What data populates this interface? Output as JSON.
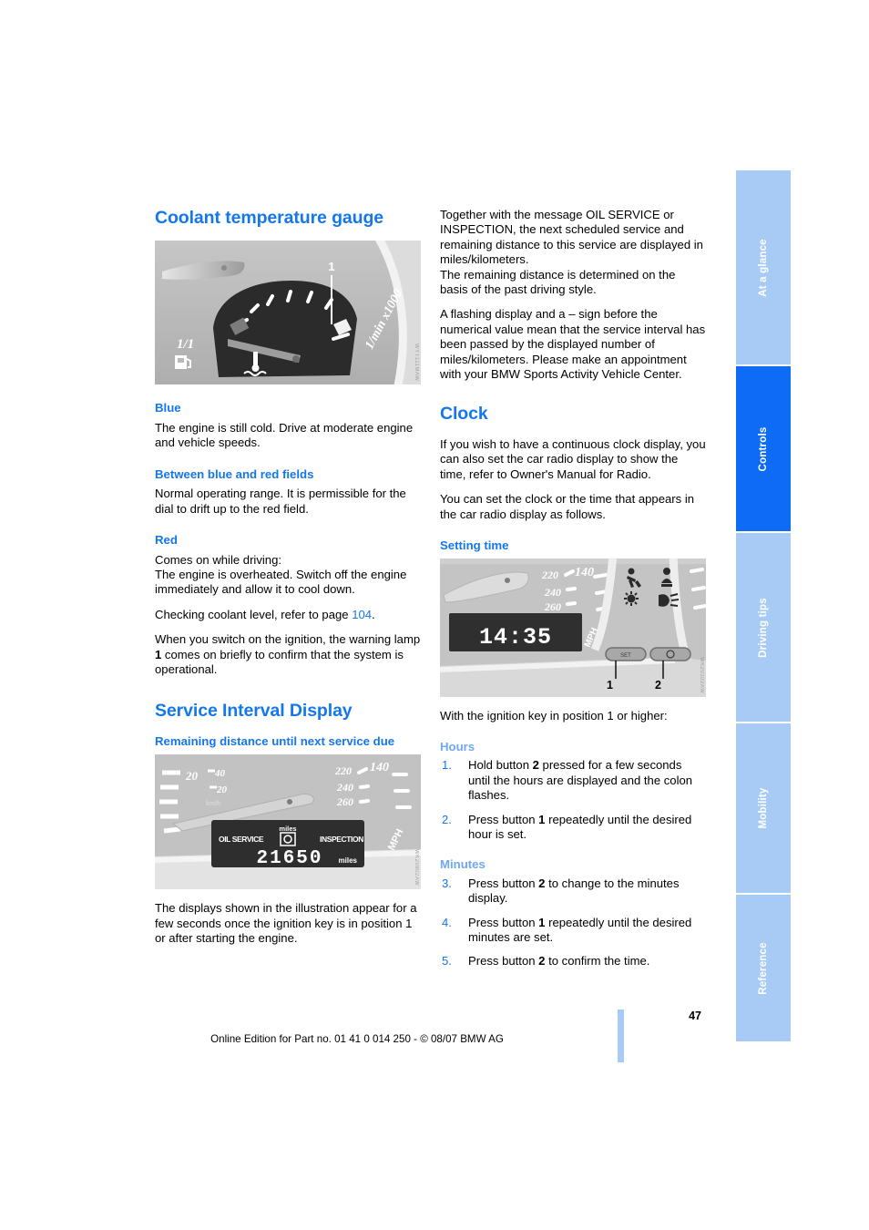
{
  "document": {
    "page_number": "47",
    "footer_text": "Online Edition for Part no. 01 41 0 014 250 - © 08/07 BMW AG"
  },
  "side_tabs": [
    {
      "label": "At a glance",
      "active": false
    },
    {
      "label": "Controls",
      "active": true
    },
    {
      "label": "Driving tips",
      "active": false
    },
    {
      "label": "Mobility",
      "active": false
    },
    {
      "label": "Reference",
      "active": false
    }
  ],
  "colors": {
    "heading_blue": "#1477ee",
    "subtle_blue": "#6fa8f5",
    "tab_inactive": "#a8cbf5",
    "tab_active": "#0e6bf5"
  },
  "left_column": {
    "heading_coolant": "Coolant temperature gauge",
    "figure_coolant": {
      "callout": "1",
      "fuel_label": "1/1",
      "tach_label": "1/min x1000",
      "watermark": "WYT111MAW"
    },
    "sub_blue": "Blue",
    "blue_text": "The engine is still cold. Drive at moderate engine and vehicle speeds.",
    "sub_between": "Between blue and red fields",
    "between_text": "Normal operating range. It is permissible for the dial to drift up to the red field.",
    "sub_red": "Red",
    "red_text_1": "Comes on while driving:",
    "red_text_2": "The engine is overheated. Switch off the engine immediately and allow it to cool down.",
    "red_text_3_pre": "Checking coolant level, refer to page ",
    "red_text_3_link": "104",
    "red_text_3_post": ".",
    "red_text_4_pre": "When you switch on the ignition, the warning lamp ",
    "red_text_4_bold": "1",
    "red_text_4_post": " comes on briefly to confirm that the system is operational.",
    "heading_service": "Service Interval Display",
    "sub_remaining": "Remaining distance until next service due",
    "figure_service": {
      "oil_service": "OIL SERVICE",
      "inspection": "INSPECTION",
      "miles_top": "miles",
      "miles_bottom": "miles",
      "value": "21650",
      "speed_20a": "20",
      "speed_40": "40",
      "speed_20b": "20",
      "kmh": "km/h",
      "speed_220": "220",
      "speed_140": "140",
      "speed_240": "240",
      "speed_260": "260",
      "mph": "MPH",
      "watermark": "WK20802AW"
    },
    "service_text": "The displays shown in the illustration appear for a few seconds once the ignition key is in position 1 or after starting the engine."
  },
  "right_column": {
    "intro_1": "Together with the message OIL SERVICE or INSPECTION, the next scheduled service and remaining distance to this service are displayed in miles/kilometers.",
    "intro_2": "The remaining distance is determined on the basis of the past driving style.",
    "intro_3": "A flashing display and a – sign before the numerical value mean that the service interval has been passed by the displayed number of miles/kilometers. Please make an appointment with your BMW Sports Activity Vehicle Center.",
    "heading_clock": "Clock",
    "clock_text_1": "If you wish to have a continuous clock display, you can also set the car radio display to show the time, refer to Owner's Manual for Radio.",
    "clock_text_2": "You can set the clock or the time that appears in the car radio display as follows.",
    "sub_setting_time": "Setting time",
    "figure_clock": {
      "time": "14:35",
      "speed_220": "220",
      "speed_140": "140",
      "speed_240": "240",
      "speed_260": "260",
      "mph": "MPH",
      "button_1_label": "1",
      "button_2_label": "2",
      "watermark": "WK20102AW"
    },
    "ignition_text": "With the ignition key in position 1 or higher:",
    "sub_hours": "Hours",
    "steps_hours": [
      {
        "num": "1.",
        "pre": "Hold button ",
        "bold": "2",
        "post": " pressed for a few seconds until the hours are displayed and the colon flashes."
      },
      {
        "num": "2.",
        "pre": "Press button ",
        "bold": "1",
        "post": " repeatedly until the desired hour is set."
      }
    ],
    "sub_minutes": "Minutes",
    "steps_minutes": [
      {
        "num": "3.",
        "pre": "Press button ",
        "bold": "2",
        "post": " to change to the minutes display."
      },
      {
        "num": "4.",
        "pre": "Press button ",
        "bold": "1",
        "post": " repeatedly until the desired minutes are set."
      },
      {
        "num": "5.",
        "pre": "Press button ",
        "bold": "2",
        "post": " to confirm the time."
      }
    ]
  }
}
